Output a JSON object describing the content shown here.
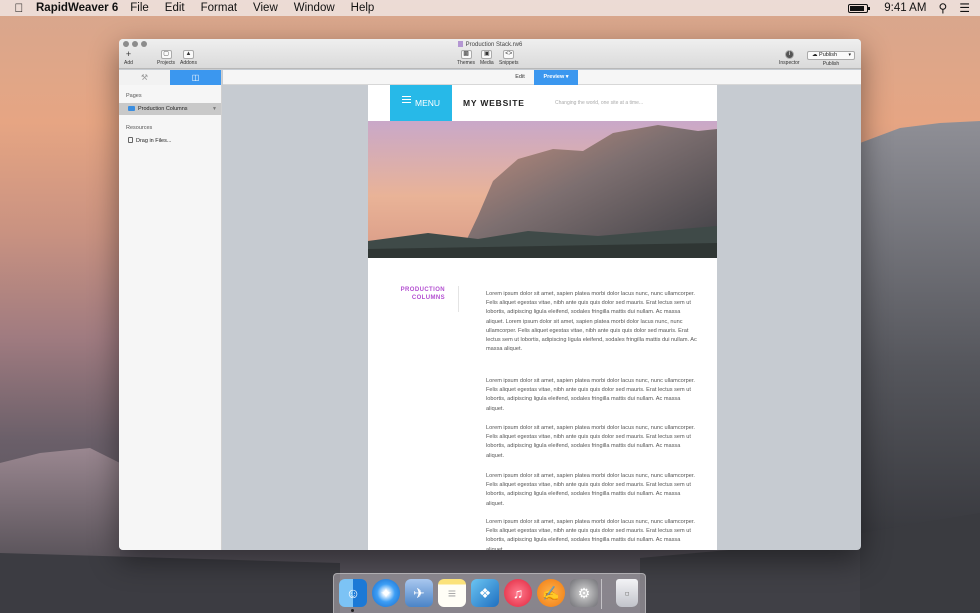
{
  "menubar": {
    "app_name": "RapidWeaver 6",
    "menus": [
      "File",
      "Edit",
      "Format",
      "View",
      "Window",
      "Help"
    ],
    "clock": "9:41 AM",
    "icons": [
      "apple-icon",
      "battery-icon",
      "spotlight-icon",
      "notification-center-icon"
    ]
  },
  "window": {
    "doc_title": "Production Stack.rw6",
    "toolbar": {
      "add": "Add",
      "projects": "Projects",
      "addons": "Addons",
      "themes": "Themes",
      "media": "Media",
      "snippets": "Snippets",
      "inspector": "Inspector",
      "publish_button": "Publish",
      "publish_label": "Publish"
    },
    "sidebar": {
      "pages_heading": "Pages",
      "page_item": "Production Columns",
      "resources_heading": "Resources",
      "resource_item": "Drag in Files..."
    },
    "mode": {
      "edit": "Edit",
      "preview": "Preview"
    }
  },
  "site": {
    "menu_label": "MENU",
    "title": "MY WEBSITE",
    "tagline": "Changing the world, one site at a time...",
    "section_label": "PRODUCTION COLUMNS",
    "paragraphs": [
      "Lorem ipsum dolor sit amet, sapien platea morbi dolor lacus nunc, nunc ullamcorper. Felis aliquet egestas vitae, nibh ante quis quis dolor sed mauris. Erat lectus sem ut lobortis, adipiscing ligula eleifend, sodales fringilla mattis dui nullam. Ac massa aliquet. Lorem ipsum dolor sit amet, sapien platea morbi dolor lacus nunc, nunc ullamcorper. Felis aliquet egestas vitae, nibh ante quis quis dolor sed mauris. Erat lectus sem ut lobortis, adipiscing ligula eleifend, sodales fringilla mattis dui nullam. Ac massa aliquet.",
      "Lorem ipsum dolor sit amet, sapien platea morbi dolor lacus nunc, nunc ullamcorper. Felis aliquet egestas vitae, nibh ante quis quis dolor sed mauris. Erat lectus sem ut lobortis, adipiscing ligula eleifend, sodales fringilla mattis dui nullam. Ac massa aliquet.",
      "Lorem ipsum dolor sit amet, sapien platea morbi dolor lacus nunc, nunc ullamcorper. Felis aliquet egestas vitae, nibh ante quis quis dolor sed mauris. Erat lectus sem ut lobortis, adipiscing ligula eleifend, sodales fringilla mattis dui nullam. Ac massa aliquet.",
      "Lorem ipsum dolor sit amet, sapien platea morbi dolor lacus nunc, nunc ullamcorper. Felis aliquet egestas vitae, nibh ante quis quis dolor sed mauris. Erat lectus sem ut lobortis, adipiscing ligula eleifend, sodales fringilla mattis dui nullam. Ac massa aliquet.",
      "Lorem ipsum dolor sit amet, sapien platea morbi dolor lacus nunc, nunc ullamcorper. Felis aliquet egestas vitae, nibh ante quis quis dolor sed mauris. Erat lectus sem ut lobortis, adipiscing ligula eleifend, sodales fringilla mattis dui nullam. Ac massa aliquet."
    ]
  },
  "dock": {
    "icons": [
      "finder-icon",
      "safari-icon",
      "preview-icon",
      "notes-icon",
      "rapidweaver-icon",
      "itunes-icon",
      "ibooks-icon",
      "system-preferences-icon",
      "trash-icon"
    ]
  },
  "colors": {
    "accent_blue": "#3b97ef",
    "menu_cyan": "#27b9e8",
    "section_purple": "#b34fd1"
  }
}
